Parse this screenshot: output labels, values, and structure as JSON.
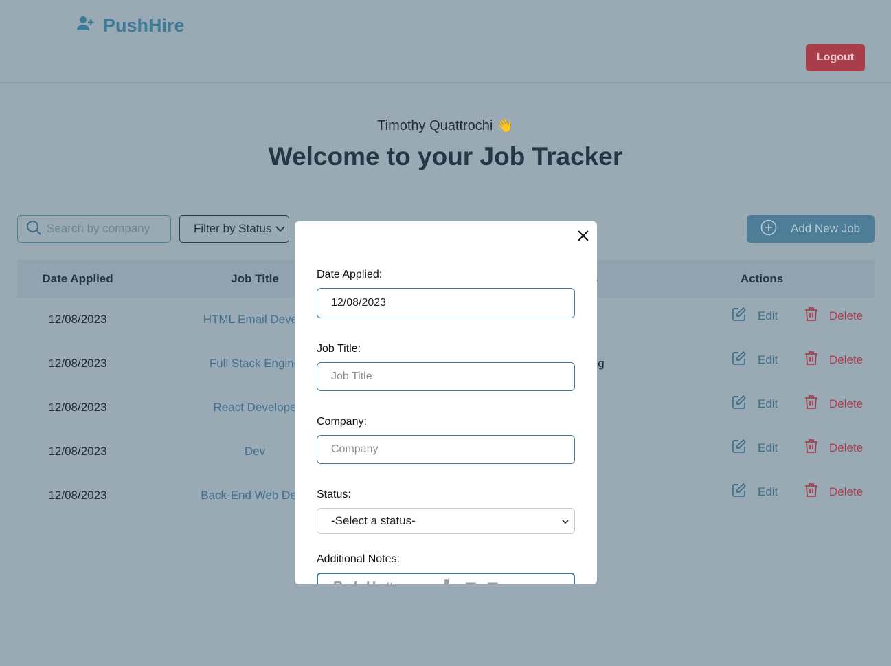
{
  "header": {
    "brand": "PushHire",
    "logout_label": "Logout"
  },
  "hero": {
    "user_name": "Timothy Quattrochi 👋",
    "title": "Welcome to your Job Tracker"
  },
  "toolbar": {
    "search_placeholder": "Search by company",
    "filter_label": "Filter by Status",
    "add_label": "Add New Job"
  },
  "table": {
    "headers": [
      "Date Applied",
      "Job Title",
      "s",
      "Actions"
    ],
    "rows": [
      {
        "date": "12/08/2023",
        "title": "HTML Email Develo",
        "status": "d"
      },
      {
        "date": "12/08/2023",
        "title": "Full Stack Engine",
        "status": "ing"
      },
      {
        "date": "12/08/2023",
        "title": "React Develope",
        "status": "d"
      },
      {
        "date": "12/08/2023",
        "title": "Dev",
        "status": "d"
      },
      {
        "date": "12/08/2023",
        "title": "Back-End Web Deve",
        "status": "d"
      }
    ],
    "edit_label": "Edit",
    "delete_label": "Delete"
  },
  "modal": {
    "date_label": "Date Applied:",
    "date_value": "12/08/2023",
    "job_title_label": "Job Title:",
    "job_title_placeholder": "Job Title",
    "company_label": "Company:",
    "company_placeholder": "Company",
    "status_label": "Status:",
    "status_selected": "-Select a status-",
    "notes_label": "Additional Notes:"
  },
  "colors": {
    "overlay_bg": "#99aab4",
    "brand": "#3f7a99",
    "danger": "#a93d4a",
    "primary_button": "#4d7d97"
  }
}
